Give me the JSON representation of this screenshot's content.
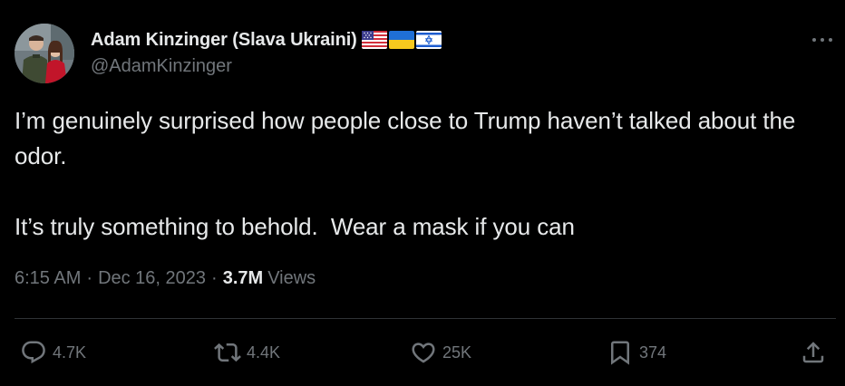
{
  "author": {
    "display_name": "Adam Kinzinger (Slava Ukraini)",
    "handle": "@AdamKinzinger",
    "flags": [
      "us-flag-icon",
      "ukraine-flag-icon",
      "israel-flag-icon"
    ]
  },
  "tweet": {
    "line1": "I’m genuinely surprised how people close to Trump haven’t talked about the odor.",
    "line2": "It’s truly something to behold.  Wear a mask if you can"
  },
  "meta": {
    "time": "6:15 AM",
    "separator": "·",
    "date": "Dec 16, 2023",
    "views_count": "3.7M",
    "views_label": "Views"
  },
  "actions": {
    "replies": "4.7K",
    "reposts": "4.4K",
    "likes": "25K",
    "bookmarks": "374"
  },
  "colors": {
    "background": "#000000",
    "text": "#e7e9ea",
    "secondary": "#71767b",
    "divider": "#2f3336"
  }
}
